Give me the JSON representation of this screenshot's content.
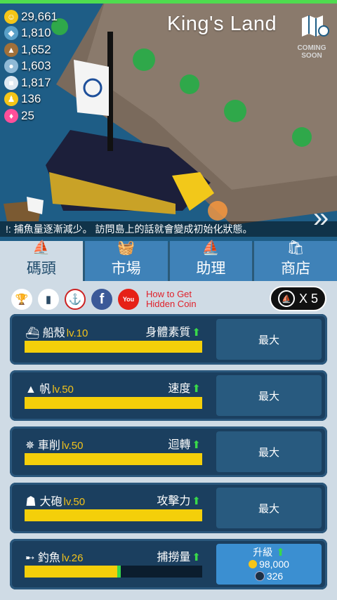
{
  "resources": [
    {
      "icon": "gold-coin-icon",
      "color": "#f5c518",
      "glyph": "☺",
      "value": "29,661"
    },
    {
      "icon": "fish-icon",
      "color": "#5aa0c8",
      "glyph": "◆",
      "value": "1,810"
    },
    {
      "icon": "wood-icon",
      "color": "#a0703a",
      "glyph": "▲",
      "value": "1,652"
    },
    {
      "icon": "pearl-icon",
      "color": "#8fb9d6",
      "glyph": "●",
      "value": "1,603"
    },
    {
      "icon": "building-icon",
      "color": "#dfe9f2",
      "glyph": "■",
      "value": "1,817"
    },
    {
      "icon": "crew-icon",
      "color": "#f5c518",
      "glyph": "♟",
      "value": "136"
    },
    {
      "icon": "gem-icon",
      "color": "#ff4f9a",
      "glyph": "♦",
      "value": "25"
    }
  ],
  "header": {
    "title": "King's Land",
    "coming_soon": "COMING SOON"
  },
  "ticker": "!: 捕魚量逐漸減少。 訪問島上的話就會變成初始化狀態。",
  "tabs": [
    {
      "label": "碼頭",
      "icon": "ship-icon",
      "glyph": "⛵"
    },
    {
      "label": "市場",
      "icon": "basket-icon",
      "glyph": "🧺"
    },
    {
      "label": "助理",
      "icon": "ship-icon",
      "glyph": "⛵"
    },
    {
      "label": "商店",
      "icon": "shop-bag-icon",
      "glyph": "🛍"
    }
  ],
  "toolbar": {
    "howto_line1": "How to Get",
    "howto_line2": "Hidden Coin",
    "multiplier": "X 5"
  },
  "upgrades": [
    {
      "name": "船殼",
      "level": "lv.10",
      "stat": "身體素質",
      "progress": 1.0,
      "button": "最大",
      "icon": "hull-icon",
      "glyph": "⛴"
    },
    {
      "name": "帆",
      "level": "lv.50",
      "stat": "速度",
      "progress": 1.0,
      "button": "最大",
      "icon": "sail-icon",
      "glyph": "▲"
    },
    {
      "name": "車削",
      "level": "lv.50",
      "stat": "迴轉",
      "progress": 1.0,
      "button": "最大",
      "icon": "helm-icon",
      "glyph": "✵"
    },
    {
      "name": "大砲",
      "level": "lv.50",
      "stat": "攻擊力",
      "progress": 1.0,
      "button": "最大",
      "icon": "cannon-icon",
      "glyph": "☗"
    },
    {
      "name": "釣魚",
      "level": "lv.26",
      "stat": "捕撈量",
      "progress": 0.53,
      "icon": "fishing-icon",
      "glyph": "➸",
      "upgrade": {
        "label": "升級",
        "coin_cost": "98,000",
        "fish_cost": "326"
      }
    }
  ]
}
